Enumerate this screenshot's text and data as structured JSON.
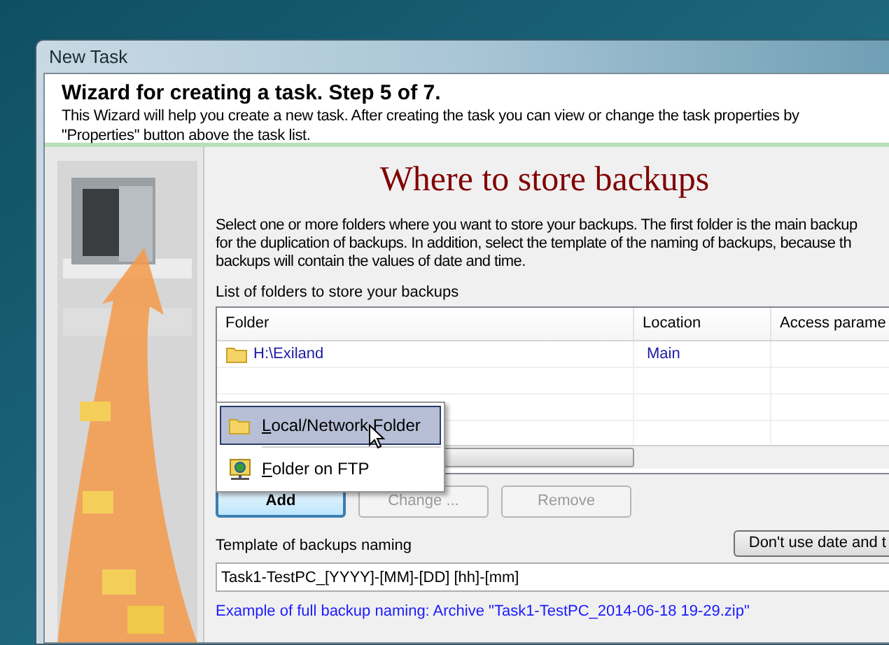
{
  "window": {
    "title": "New Task"
  },
  "header": {
    "title": "Wizard for creating a task. Step 5 of 7.",
    "description_lines": [
      "This Wizard will help you create a new task. After creating the task you can view or change the task properties by",
      "\"Properties\" button above the task list."
    ]
  },
  "page": {
    "heading": "Where to store backups",
    "intro_lines": [
      "Select one or more folders where you want to store your backups. The first folder is the main backup",
      "for the duplication of backups. In addition, select the template of the naming of backups, because th",
      "backups will contain the values of date and time."
    ],
    "list_label": "List of folders to store your backups"
  },
  "table": {
    "columns": [
      "Folder",
      "Location",
      "Access parame"
    ],
    "rows": [
      {
        "folder": "H:\\Exiland",
        "location": "Main",
        "access": ""
      }
    ]
  },
  "add_menu": {
    "items": [
      {
        "label": "Local/Network Folder",
        "kind": "folder",
        "selected": true
      },
      {
        "label": "Folder on FTP",
        "kind": "ftp",
        "selected": false
      }
    ]
  },
  "buttons": [
    {
      "label": "Add",
      "disabled": false,
      "default": true
    },
    {
      "label": "Change ...",
      "disabled": true,
      "default": false
    },
    {
      "label": "Remove",
      "disabled": true,
      "default": false
    }
  ],
  "naming": {
    "label": "Template of backups naming",
    "toggle_button": "Don't use date and t",
    "value": "Task1-TestPC_[YYYY]-[MM]-[DD] [hh]-[mm]",
    "example": "Example of full backup naming: Archive \"Task1-TestPC_2014-06-18 19-29.zip\""
  }
}
